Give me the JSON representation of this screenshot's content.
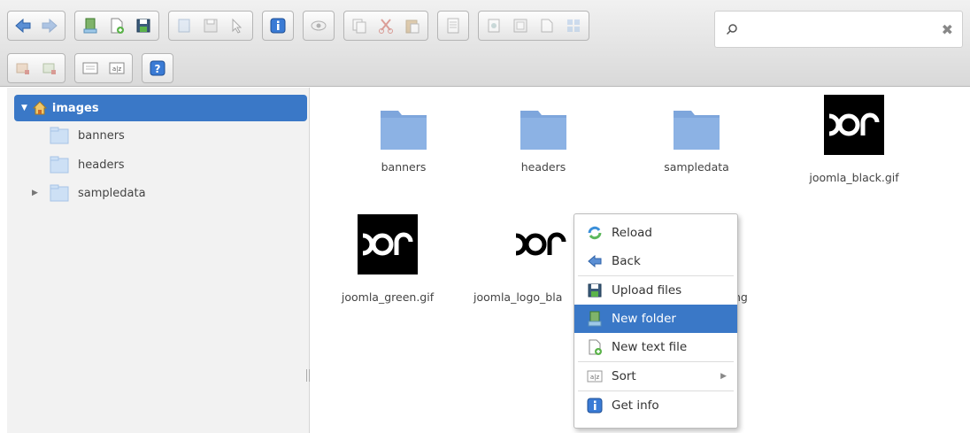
{
  "toolbar": {
    "row1": [
      {
        "buttons": [
          {
            "icon": "back-arrow-icon"
          },
          {
            "icon": "forward-arrow-icon"
          }
        ]
      },
      {
        "buttons": [
          {
            "icon": "new-folder-icon"
          },
          {
            "icon": "new-file-icon"
          },
          {
            "icon": "upload-icon"
          }
        ]
      },
      {
        "buttons": [
          {
            "icon": "open-icon"
          },
          {
            "icon": "download-icon"
          },
          {
            "icon": "select-icon"
          }
        ]
      },
      {
        "buttons": [
          {
            "icon": "info-icon"
          }
        ]
      },
      {
        "buttons": [
          {
            "icon": "preview-icon"
          }
        ]
      },
      {
        "buttons": [
          {
            "icon": "copy-icon"
          },
          {
            "icon": "cut-icon"
          },
          {
            "icon": "paste-icon"
          }
        ]
      },
      {
        "buttons": [
          {
            "icon": "rename-icon"
          }
        ]
      },
      {
        "buttons": [
          {
            "icon": "duplicate-icon"
          },
          {
            "icon": "extract-icon"
          },
          {
            "icon": "archive-icon"
          },
          {
            "icon": "grid-icon"
          }
        ]
      }
    ],
    "row2": [
      {
        "buttons": [
          {
            "icon": "resize-icon"
          },
          {
            "icon": "edit-icon"
          }
        ]
      },
      {
        "buttons": [
          {
            "icon": "view-icon"
          },
          {
            "icon": "sort-icon"
          }
        ]
      },
      {
        "buttons": [
          {
            "icon": "help-icon"
          }
        ]
      }
    ]
  },
  "search": {
    "placeholder": "",
    "value": ""
  },
  "sidebar": {
    "root": "images",
    "items": [
      {
        "label": "banners",
        "expandable": false
      },
      {
        "label": "headers",
        "expandable": false
      },
      {
        "label": "sampledata",
        "expandable": true
      }
    ]
  },
  "files": [
    {
      "name": "banners",
      "kind": "folder"
    },
    {
      "name": "headers",
      "kind": "folder"
    },
    {
      "name": "sampledata",
      "kind": "folder"
    },
    {
      "name": "joomla_black.gif",
      "kind": "image"
    },
    {
      "name": "joomla_green.gif",
      "kind": "image"
    },
    {
      "name": "joomla_logo_bla",
      "kind": "image"
    },
    {
      "name": "ng",
      "kind": "partial"
    }
  ],
  "context_menu": {
    "items": [
      {
        "label": "Reload",
        "icon": "reload-icon"
      },
      {
        "label": "Back",
        "icon": "back-icon"
      },
      {
        "label": "Upload files",
        "icon": "upload-files-icon"
      },
      {
        "label": "New folder",
        "icon": "new-folder-icon",
        "active": true
      },
      {
        "label": "New text file",
        "icon": "new-text-file-icon"
      },
      {
        "label": "Sort",
        "icon": "sort-icon",
        "submenu": true
      },
      {
        "label": "Get info",
        "icon": "info-icon"
      }
    ]
  },
  "colors": {
    "selection": "#3a78c7",
    "folder": "#7ea6dc"
  }
}
